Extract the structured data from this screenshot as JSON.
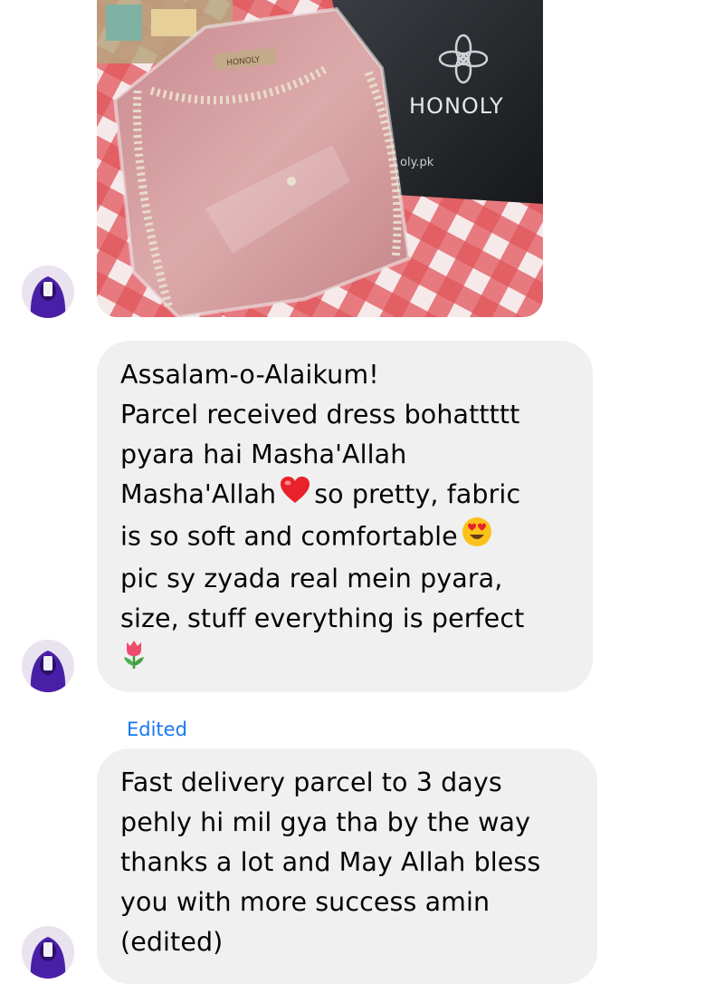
{
  "photo": {
    "tag_text": "HONOLY",
    "bag_brand": "HONOLY",
    "bag_url": "oly.pk"
  },
  "messages": [
    {
      "lines": [
        "Assalam-o-Alaikum!",
        "Parcel received dress bohattttt",
        "pyara hai Masha'Allah",
        "Masha'Allah",
        "so pretty, fabric",
        "is so soft and comfortable",
        "pic sy zyada real mein pyara,",
        "size, stuff everything is perfect"
      ],
      "emojis": [
        "red-heart",
        "heart-eyes",
        "tulip"
      ]
    },
    {
      "edited_label": "Edited",
      "lines": [
        "Fast delivery parcel to 3 days",
        "pehly hi mil gya tha by the way",
        "thanks a lot and May Allah bless",
        "you with more success amin",
        "(edited)"
      ]
    }
  ],
  "colors": {
    "bubble_bg": "#f0f0f0",
    "edited_link": "#1877f2",
    "dress_pink": "#d69a9c",
    "tablecloth_red": "#d8363c"
  }
}
